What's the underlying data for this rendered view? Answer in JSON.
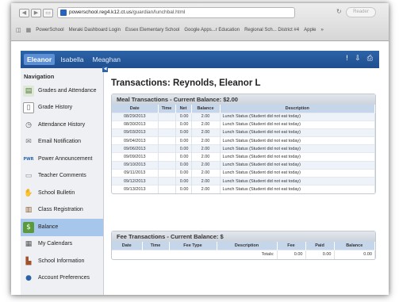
{
  "browser": {
    "url_host": "powerschool.reg4.k12.ct.us",
    "url_path": "/guardian/lunchbal.html",
    "reader_label": "Reader",
    "bookmarks": [
      "PowerSchool",
      "Meraki Dashboard Login",
      "Essex Elementary School",
      "Google Apps...r Education",
      "Regional Sch... District #4",
      "Apple"
    ],
    "more": "»"
  },
  "header": {
    "students": [
      "Eleanor",
      "Isabella",
      "Meaghan"
    ],
    "active_student": "Eleanor"
  },
  "sidebar": {
    "title": "Navigation",
    "items": [
      {
        "label": "Grades and Attendance",
        "icon": "gradebook-icon"
      },
      {
        "label": "Grade History",
        "icon": "document-icon"
      },
      {
        "label": "Attendance History",
        "icon": "clock-icon"
      },
      {
        "label": "Email Notification",
        "icon": "envelope-icon"
      },
      {
        "label": "Power Announcement",
        "icon": "announcement-icon"
      },
      {
        "label": "Teacher Comments",
        "icon": "comment-icon"
      },
      {
        "label": "School Bulletin",
        "icon": "bulletin-icon"
      },
      {
        "label": "Class Registration",
        "icon": "registration-icon"
      },
      {
        "label": "Balance",
        "icon": "money-icon",
        "active": true
      },
      {
        "label": "My Calendars",
        "icon": "calendar-icon"
      },
      {
        "label": "School Information",
        "icon": "building-icon"
      },
      {
        "label": "Account Preferences",
        "icon": "user-icon"
      }
    ]
  },
  "main": {
    "title": "Transactions: Reynolds, Eleanor L",
    "meal": {
      "header": "Meal Transactions - Current Balance: $2.00",
      "columns": [
        "Date",
        "Time",
        "Net",
        "Balance",
        "Description"
      ],
      "rows": [
        [
          "08/29/2013",
          "",
          "0.00",
          "2.00",
          "Lunch Status (Student did not eat today)"
        ],
        [
          "08/30/2013",
          "",
          "0.00",
          "2.00",
          "Lunch Status (Student did not eat today)"
        ],
        [
          "09/03/2013",
          "",
          "0.00",
          "2.00",
          "Lunch Status (Student did not eat today)"
        ],
        [
          "09/04/2013",
          "",
          "0.00",
          "2.00",
          "Lunch Status (Student did not eat today)"
        ],
        [
          "09/06/2013",
          "",
          "0.00",
          "2.00",
          "Lunch Status (Student did not eat today)"
        ],
        [
          "09/09/2013",
          "",
          "0.00",
          "2.00",
          "Lunch Status (Student did not eat today)"
        ],
        [
          "09/10/2013",
          "",
          "0.00",
          "2.00",
          "Lunch Status (Student did not eat today)"
        ],
        [
          "09/11/2013",
          "",
          "0.00",
          "2.00",
          "Lunch Status (Student did not eat today)"
        ],
        [
          "09/12/2013",
          "",
          "0.00",
          "2.00",
          "Lunch Status (Student did not eat today)"
        ],
        [
          "09/13/2013",
          "",
          "0.00",
          "2.00",
          "Lunch Status (Student did not eat today)"
        ]
      ]
    },
    "fee": {
      "header": "Fee Transactions - Current Balance: $",
      "columns": [
        "Date",
        "Time",
        "Fee Type",
        "Description",
        "Fee",
        "Paid",
        "Balance"
      ],
      "totals_label": "Totals:",
      "totals": [
        "0.00",
        "0.00",
        "0.00"
      ]
    }
  },
  "colors": {
    "header_blue": "#2c63a8",
    "active_tab": "#5c8fd4",
    "sidebar_active": "#a6c6ec",
    "table_header": "#c6d6ea"
  }
}
